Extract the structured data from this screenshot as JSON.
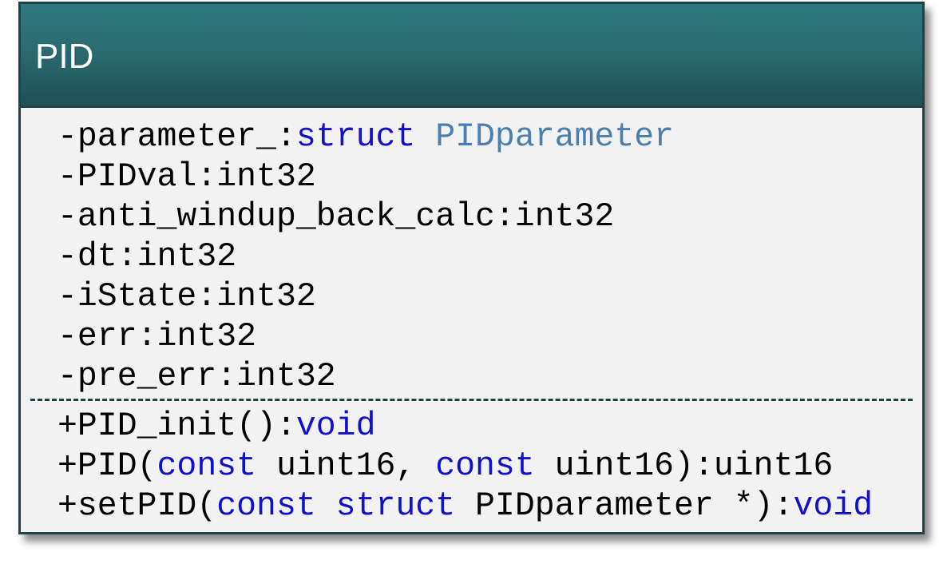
{
  "class": {
    "name": "PID",
    "attributes": [
      {
        "prefix": "-parameter_:",
        "kw": "struct",
        "sep": " ",
        "ref": "PIDparameter"
      },
      {
        "text": "-PIDval:int32"
      },
      {
        "text": "-anti_windup_back_calc:int32"
      },
      {
        "text": "-dt:int32"
      },
      {
        "text": "-iState:int32"
      },
      {
        "text": "-err:int32"
      },
      {
        "text": "-pre_err:int32"
      }
    ],
    "operations": [
      {
        "prefix": "+PID_init():",
        "ret": "void"
      },
      {
        "prefix": "+PID(",
        "kw1": "const",
        "mid1": " uint16, ",
        "kw2": "const",
        "mid2": " uint16):uint16"
      },
      {
        "prefix": "+setPID(",
        "kw1": "const",
        "sp": " ",
        "kw2": "struct",
        "mid": " PIDparameter *):",
        "ret": "void"
      }
    ]
  },
  "colors": {
    "header_top": "#2f7a7f",
    "header_bottom": "#1f4f53",
    "border": "#1d4448",
    "body_bg": "#f2f2f2",
    "keyword": "#1111cc",
    "type_reference": "#4a7fae",
    "text": "#000000"
  }
}
